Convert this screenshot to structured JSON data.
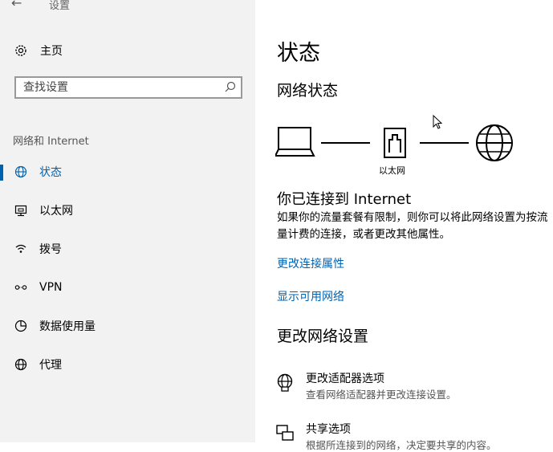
{
  "window": {
    "title": "设置"
  },
  "sidebar": {
    "home_label": "主页",
    "search_placeholder": "查找设置",
    "section_title": "网络和 Internet",
    "items": [
      {
        "label": "状态",
        "icon": "globe-icon",
        "selected": true
      },
      {
        "label": "以太网",
        "icon": "ethernet-icon",
        "selected": false
      },
      {
        "label": "拨号",
        "icon": "dialup-icon",
        "selected": false
      },
      {
        "label": "VPN",
        "icon": "vpn-icon",
        "selected": false
      },
      {
        "label": "数据使用量",
        "icon": "data-usage-icon",
        "selected": false
      },
      {
        "label": "代理",
        "icon": "globe-icon",
        "selected": false
      }
    ]
  },
  "main": {
    "title": "状态",
    "network_status_heading": "网络状态",
    "diagram_label": "以太网",
    "connected_title": "你已连接到 Internet",
    "description": "如果你的流量套餐有限制，则你可以将此网络设置为按流量计费的连接，或者更改其他属性。",
    "links": [
      "更改连接属性",
      "显示可用网络"
    ],
    "change_settings_heading": "更改网络设置",
    "options": [
      {
        "title": "更改适配器选项",
        "subtitle": "查看网络适配器并更改连接设置。",
        "icon": "adapter-globe-icon"
      },
      {
        "title": "共享选项",
        "subtitle": "根据所连接到的网络，决定要共享的内容。",
        "icon": "sharing-icon"
      }
    ]
  },
  "colors": {
    "accent": "#0063b1",
    "sidebar_bg": "#f2f2f2"
  }
}
